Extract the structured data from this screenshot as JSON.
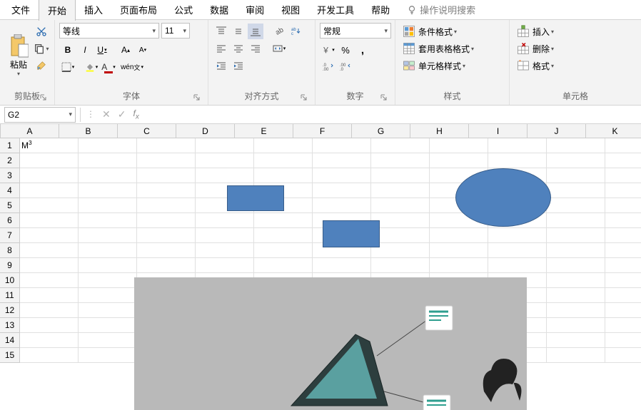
{
  "menu": {
    "tabs": [
      "文件",
      "开始",
      "插入",
      "页面布局",
      "公式",
      "数据",
      "审阅",
      "视图",
      "开发工具",
      "帮助"
    ],
    "search": "操作说明搜索",
    "active_index": 1
  },
  "ribbon": {
    "clipboard": {
      "label": "剪贴板",
      "paste": "粘贴"
    },
    "font": {
      "label": "字体",
      "name": "等线",
      "size": "11"
    },
    "align": {
      "label": "对齐方式"
    },
    "number": {
      "label": "数字",
      "format": "常规"
    },
    "styles": {
      "label": "样式",
      "cond_fmt": "条件格式",
      "table_fmt": "套用表格格式",
      "cell_style": "单元格样式"
    },
    "cells": {
      "label": "单元格",
      "insert": "插入",
      "delete": "删除",
      "format": "格式"
    }
  },
  "namebox": {
    "ref": "G2"
  },
  "grid": {
    "columns": [
      "A",
      "B",
      "C",
      "D",
      "E",
      "F",
      "G",
      "H",
      "I",
      "J",
      "K"
    ],
    "rows": [
      "1",
      "2",
      "3",
      "4",
      "5",
      "6",
      "7",
      "8",
      "9",
      "10",
      "11",
      "12",
      "13",
      "14",
      "15"
    ],
    "cells": {
      "A1": "M³"
    }
  }
}
